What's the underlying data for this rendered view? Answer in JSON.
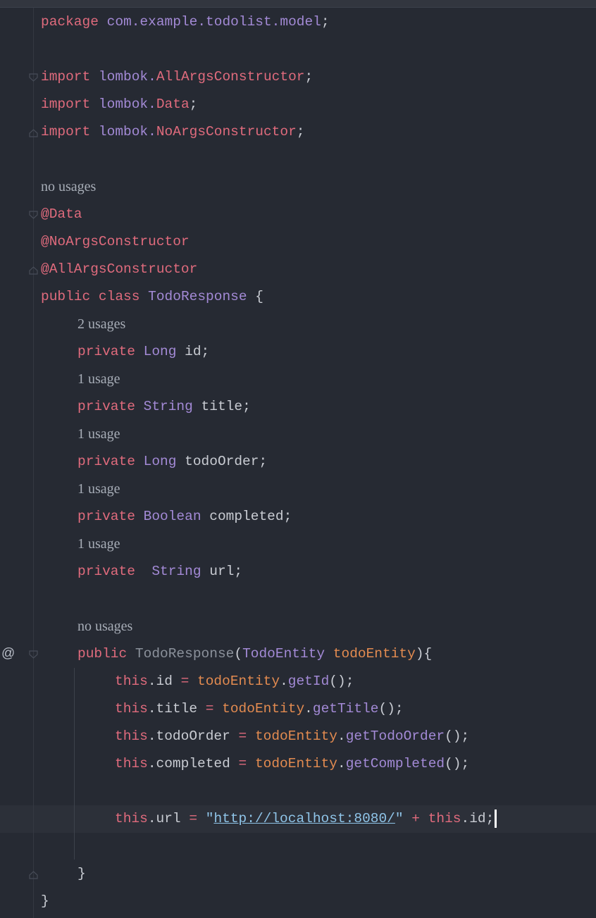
{
  "editor": {
    "language": "java",
    "gutter_marker": "@",
    "colors": {
      "background": "#262a33",
      "keyword": "#e06b7d",
      "type": "#a38ad6",
      "parameter": "#e38b50",
      "string": "#8fc4e8",
      "hint": "#a7adb7",
      "current_line": "#2c3039"
    }
  },
  "code": {
    "package_kw": "package",
    "package_name": "com.example.todolist.model",
    "semicolon": ";",
    "import_kw": "import",
    "lombok_prefix": "lombok.",
    "imports": [
      "AllArgsConstructor",
      "Data",
      "NoArgsConstructor"
    ],
    "class_usage_hint": "no usages",
    "annotations": [
      "@Data",
      "@NoArgsConstructor",
      "@AllArgsConstructor"
    ],
    "public_kw": "public",
    "class_kw": "class",
    "class_name": "TodoResponse",
    "open_brace": "{",
    "close_brace": "}",
    "private_kw": "private",
    "fields": [
      {
        "hint": "2 usages",
        "type": "Long",
        "name": "id"
      },
      {
        "hint": "1 usage",
        "type": "String",
        "name": "title"
      },
      {
        "hint": "1 usage",
        "type": "Long",
        "name": "todoOrder"
      },
      {
        "hint": "1 usage",
        "type": "Boolean",
        "name": "completed"
      },
      {
        "hint": "1 usage",
        "type": "String",
        "name": "url"
      }
    ],
    "ctor_usage_hint": "no usages",
    "ctor_param_type": "TodoEntity",
    "ctor_param_name": "todoEntity",
    "this_kw": "this",
    "assignments": [
      {
        "field": "id",
        "getter": "getId"
      },
      {
        "field": "title",
        "getter": "getTitle"
      },
      {
        "field": "todoOrder",
        "getter": "getTodoOrder"
      },
      {
        "field": "completed",
        "getter": "getCompleted"
      }
    ],
    "url_string": "http://localhost:8080/"
  }
}
